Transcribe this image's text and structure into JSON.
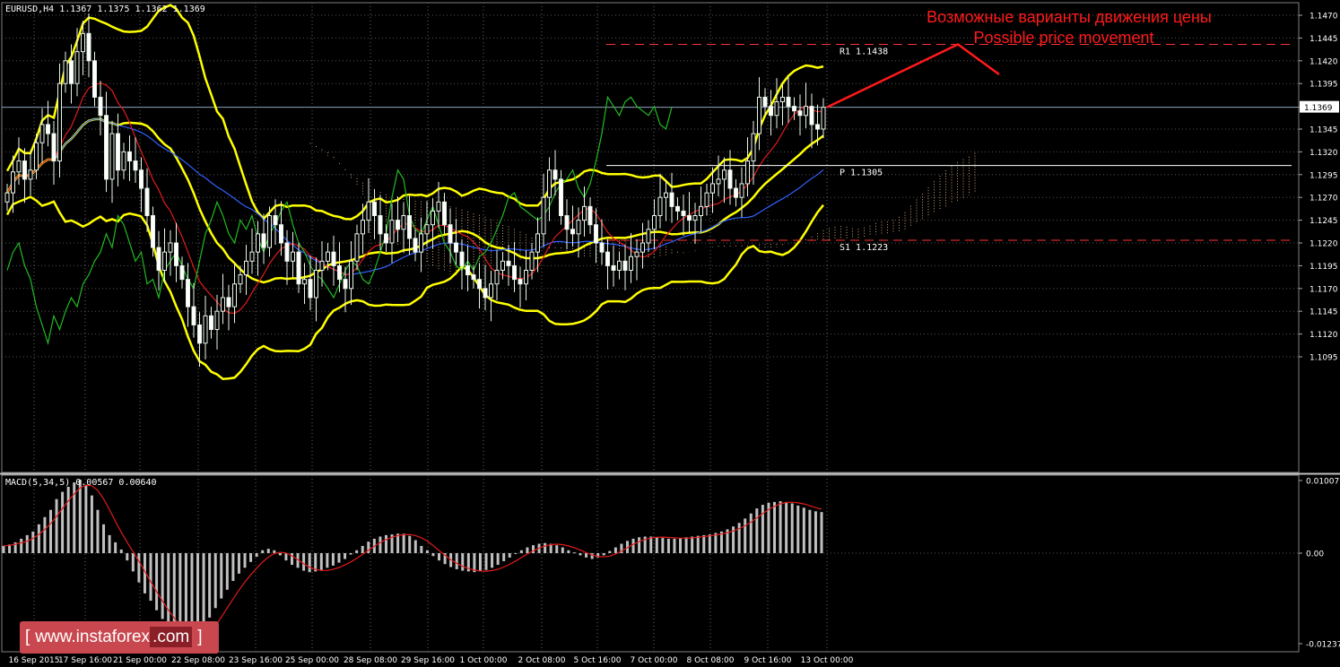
{
  "window": {
    "header": "EURUSD,H4  1.1367 1.1375 1.1362 1.1369",
    "annotation_ru": "Возможные варианты движения цены",
    "annotation_en": "Possible price movement",
    "macd_header": "MACD(5,34,5) 0.00567 0.00640",
    "logo": {
      "bracket_left": "[",
      "text": "www.instaforex",
      "domain": ".com",
      "bracket_right": "]"
    }
  },
  "chart_data": [
    {
      "type": "candlestick",
      "symbol": "EURUSD",
      "timeframe": "H4",
      "title": "EURUSD,H4  1.1367 1.1375 1.1362 1.1369",
      "ylim": [
        1.1085,
        1.1485
      ],
      "y_ticks": [
        "1.1470",
        "1.1445",
        "1.1420",
        "1.1395",
        "1.1369",
        "1.1345",
        "1.1320",
        "1.1295",
        "1.1270",
        "1.1245",
        "1.1220",
        "1.1195",
        "1.1170",
        "1.1145",
        "1.1120",
        "1.1095"
      ],
      "current_price": "1.1369",
      "x_labels": [
        "16 Sep 2015",
        "17 Sep 16:00",
        "21 Sep 00:00",
        "22 Sep 08:00",
        "23 Sep 16:00",
        "25 Sep 00:00",
        "28 Sep 08:00",
        "29 Sep 16:00",
        "1 Oct 00:00",
        "2 Oct 08:00",
        "5 Oct 16:00",
        "7 Oct 00:00",
        "8 Oct 08:00",
        "9 Oct 16:00",
        "13 Oct 00:00"
      ],
      "levels": [
        {
          "name": "R1",
          "label": "R1  1.1438",
          "value": 1.1438,
          "style": "dashed",
          "color": "#ff3333"
        },
        {
          "name": "P",
          "label": "P  1.1305",
          "value": 1.1305,
          "style": "solid",
          "color": "#ffffff"
        },
        {
          "name": "S1",
          "label": "S1  1.1223",
          "value": 1.1223,
          "style": "dashed",
          "color": "#ff3333"
        }
      ],
      "closes": [
        1.1275,
        1.1298,
        1.131,
        1.129,
        1.13,
        1.133,
        1.135,
        1.134,
        1.131,
        1.1395,
        1.142,
        1.1395,
        1.143,
        1.145,
        1.142,
        1.138,
        1.136,
        1.129,
        1.134,
        1.13,
        1.132,
        1.131,
        1.13,
        1.128,
        1.125,
        1.1215,
        1.119,
        1.121,
        1.122,
        1.1195,
        1.118,
        1.115,
        1.113,
        1.111,
        1.114,
        1.1125,
        1.1145,
        1.116,
        1.115,
        1.1175,
        1.1185,
        1.12,
        1.121,
        1.123,
        1.1215,
        1.125,
        1.124,
        1.122,
        1.12,
        1.121,
        1.1175,
        1.118,
        1.116,
        1.119,
        1.12,
        1.121,
        1.1195,
        1.118,
        1.117,
        1.12,
        1.123,
        1.1245,
        1.1265,
        1.125,
        1.123,
        1.122,
        1.1245,
        1.1235,
        1.125,
        1.1225,
        1.121,
        1.123,
        1.124,
        1.1255,
        1.1265,
        1.124,
        1.122,
        1.121,
        1.1195,
        1.1185,
        1.118,
        1.117,
        1.116,
        1.1175,
        1.119,
        1.12,
        1.1195,
        1.118,
        1.1175,
        1.119,
        1.121,
        1.123,
        1.127,
        1.13,
        1.129,
        1.125,
        1.1235,
        1.123,
        1.1245,
        1.126,
        1.124,
        1.122,
        1.121,
        1.1195,
        1.119,
        1.12,
        1.119,
        1.1205,
        1.121,
        1.122,
        1.1235,
        1.125,
        1.127,
        1.1275,
        1.126,
        1.1255,
        1.125,
        1.1245,
        1.125,
        1.126,
        1.1275,
        1.1285,
        1.129,
        1.13,
        1.128,
        1.127,
        1.1285,
        1.131,
        1.134,
        1.138,
        1.137,
        1.136,
        1.1375,
        1.138,
        1.137,
        1.1365,
        1.136,
        1.137,
        1.135,
        1.1345,
        1.1369
      ],
      "indicators": {
        "bollinger": {
          "color": "#ffff00"
        },
        "moving_average": {
          "color": "#3060ff"
        },
        "tenkan": {
          "color": "#e21b1b"
        },
        "chikou": {
          "color": "#22bb22"
        },
        "kumo": {
          "color": "#ffcc99"
        }
      }
    },
    {
      "type": "bar",
      "title": "MACD(5,34,5) 0.00567 0.00640",
      "series": [
        {
          "name": "MACD"
        }
      ],
      "ylim": [
        -0.01237,
        0.01007
      ],
      "y_ticks": [
        "0.01007",
        "0.00",
        "-0.01237"
      ],
      "histogram": [
        0.001,
        0.0012,
        0.0015,
        0.002,
        0.0025,
        0.003,
        0.004,
        0.005,
        0.006,
        0.0075,
        0.0085,
        0.0092,
        0.0098,
        0.0102,
        0.0095,
        0.008,
        0.006,
        0.004,
        0.0025,
        0.0015,
        0.0005,
        -0.001,
        -0.0025,
        -0.004,
        -0.0055,
        -0.0065,
        -0.0078,
        -0.009,
        -0.01,
        -0.011,
        -0.0118,
        -0.0122,
        -0.012,
        -0.0112,
        -0.01,
        -0.0088,
        -0.0075,
        -0.0062,
        -0.005,
        -0.0038,
        -0.0028,
        -0.002,
        -0.0012,
        -0.0005,
        0.0004,
        0.0006,
        0.0004,
        -0.0003,
        -0.001,
        -0.0016,
        -0.002,
        -0.0024,
        -0.0026,
        -0.0025,
        -0.0023,
        -0.002,
        -0.0017,
        -0.0013,
        -0.0008,
        -0.0002,
        0.0004,
        0.001,
        0.0016,
        0.002,
        0.0023,
        0.0025,
        0.0026,
        0.0027,
        0.0027,
        0.0024,
        0.0018,
        0.001,
        0.0004,
        -0.0004,
        -0.001,
        -0.0015,
        -0.0019,
        -0.0022,
        -0.0024,
        -0.0025,
        -0.0026,
        -0.0025,
        -0.0023,
        -0.002,
        -0.0016,
        -0.0011,
        -0.0006,
        -0.0001,
        0.0004,
        0.0008,
        0.0011,
        0.0013,
        0.0014,
        0.0013,
        0.0011,
        0.0008,
        0.0004,
        0.0001,
        -0.0003,
        -0.0006,
        -0.0008,
        -0.0006,
        -0.0003,
        0.0003,
        0.0008,
        0.0013,
        0.0017,
        0.002,
        0.0022,
        0.0023,
        0.0023,
        0.0022,
        0.0021,
        0.002,
        0.002,
        0.0021,
        0.0022,
        0.0023,
        0.0024,
        0.0025,
        0.0026,
        0.0028,
        0.003,
        0.0033,
        0.0037,
        0.0042,
        0.0048,
        0.0055,
        0.0062,
        0.0067,
        0.007,
        0.0071,
        0.0072,
        0.0071,
        0.0069,
        0.0066,
        0.0063,
        0.006,
        0.0058,
        0.0057
      ],
      "signal_color": "#e21b1b",
      "histogram_color": "#c0c0c0"
    }
  ]
}
